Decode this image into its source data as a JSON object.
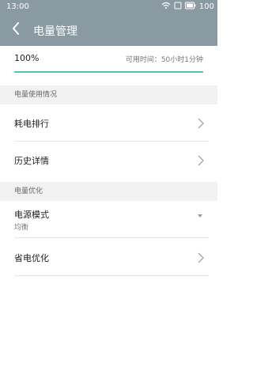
{
  "status": {
    "time": "13:00",
    "battery": "100"
  },
  "appbar": {
    "title": "电量管理"
  },
  "battery": {
    "percent": "100%",
    "available_time": "可用时间：50小时1分钟"
  },
  "sections": {
    "usage": {
      "header": "电量使用情况",
      "items": [
        {
          "label": "耗电排行"
        },
        {
          "label": "历史详情"
        }
      ]
    },
    "optimize": {
      "header": "电量优化",
      "power_mode": {
        "label": "电源模式",
        "value": "均衡"
      },
      "saver": {
        "label": "省电优化"
      }
    }
  }
}
